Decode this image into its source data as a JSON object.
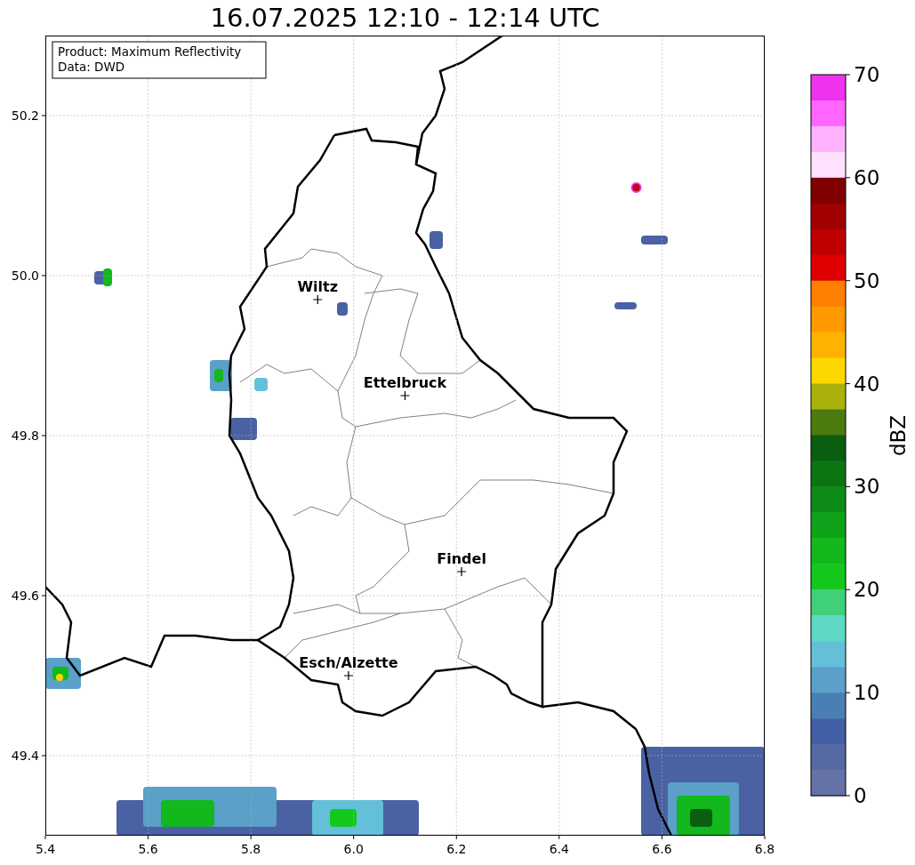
{
  "title": "16.07.2025 12:10 - 12:14 UTC",
  "info": [
    "Product: Maximum Reflectivity",
    "Data: DWD"
  ],
  "map": {
    "xticks": [
      "5.4",
      "5.6",
      "5.8",
      "6.0",
      "6.2",
      "6.4",
      "6.6",
      "6.8"
    ],
    "yticks": [
      "50.2",
      "50.0",
      "49.8",
      "49.6",
      "49.4"
    ],
    "cities": [
      {
        "label": "Wiltz"
      },
      {
        "label": "Ettelbruck"
      },
      {
        "label": "Findel"
      },
      {
        "label": "Esch/Alzette"
      }
    ]
  },
  "colorbar": {
    "label": "dBZ",
    "ticks": [
      "70",
      "60",
      "50",
      "40",
      "30",
      "20",
      "10",
      "0"
    ],
    "bins": [
      {
        "color": "#ee33ee"
      },
      {
        "color": "#ff66ff"
      },
      {
        "color": "#ffb3ff"
      },
      {
        "color": "#ffe0ff"
      },
      {
        "color": "#800000"
      },
      {
        "color": "#a00000"
      },
      {
        "color": "#c00000"
      },
      {
        "color": "#e00000"
      },
      {
        "color": "#ff7f00"
      },
      {
        "color": "#ff9900"
      },
      {
        "color": "#ffb300"
      },
      {
        "color": "#ffd700"
      },
      {
        "color": "#aab10d"
      },
      {
        "color": "#4d7a0e"
      },
      {
        "color": "#0a5e10"
      },
      {
        "color": "#0b7514"
      },
      {
        "color": "#0d8c17"
      },
      {
        "color": "#0fa31a"
      },
      {
        "color": "#12b81c"
      },
      {
        "color": "#13c81d"
      },
      {
        "color": "#40d07a"
      },
      {
        "color": "#5ed8c4"
      },
      {
        "color": "#63c0d8"
      },
      {
        "color": "#5aa0c8"
      },
      {
        "color": "#4a7fb3"
      },
      {
        "color": "#4260a5"
      },
      {
        "color": "#5669a3"
      },
      {
        "color": "#6472a6"
      }
    ]
  }
}
